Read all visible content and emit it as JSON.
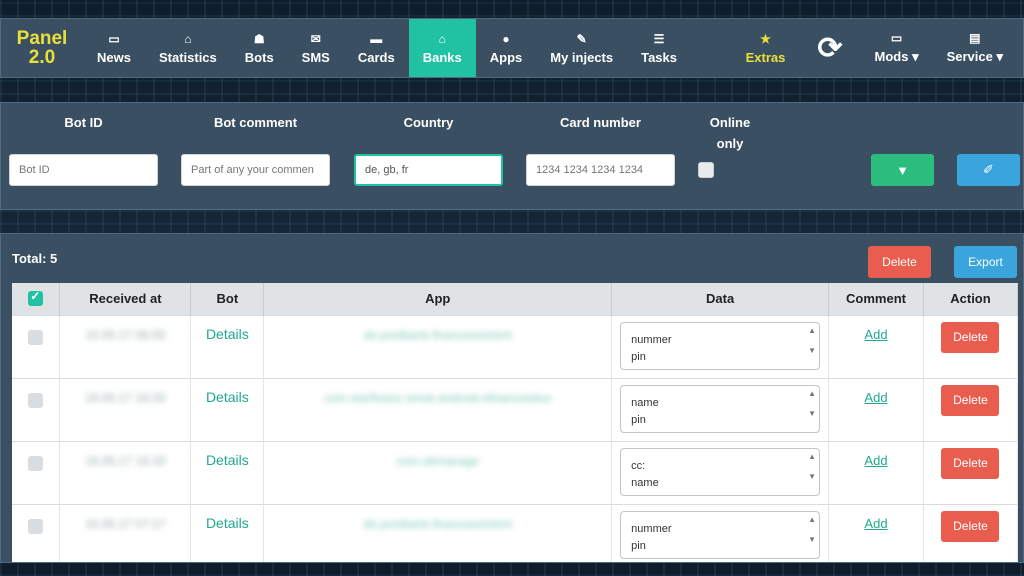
{
  "logo": {
    "line1": "Panel",
    "line2": "2.0"
  },
  "nav": [
    {
      "icon": "news-icon",
      "glyph": "▭",
      "label": "News",
      "active": false
    },
    {
      "icon": "chart-icon",
      "glyph": "⌂",
      "label": "Statistics",
      "active": false
    },
    {
      "icon": "bots-icon",
      "glyph": "☗",
      "label": "Bots",
      "active": false
    },
    {
      "icon": "envelope-icon",
      "glyph": "✉",
      "label": "SMS",
      "active": false
    },
    {
      "icon": "card-icon",
      "glyph": "▬",
      "label": "Cards",
      "active": false
    },
    {
      "icon": "bank-icon",
      "glyph": "⌂",
      "label": "Banks",
      "active": true
    },
    {
      "icon": "android-icon",
      "glyph": "●",
      "label": "Apps",
      "active": false
    },
    {
      "icon": "syringe-icon",
      "glyph": "✎",
      "label": "My injects",
      "active": false
    },
    {
      "icon": "tasks-icon",
      "glyph": "☰",
      "label": "Tasks",
      "active": false
    }
  ],
  "extras": {
    "glyph": "★",
    "label": "Extras"
  },
  "refresh_glyph": "⟳",
  "mods": {
    "glyph": "▭",
    "label": "Mods ▾"
  },
  "service": {
    "glyph": "▤",
    "label": "Service ▾"
  },
  "filters": {
    "bot_id_label": "Bot ID",
    "bot_id_placeholder": "Bot ID",
    "bot_comment_label": "Bot comment",
    "bot_comment_placeholder": "Part of any your commen",
    "country_label": "Country",
    "country_value": "de, gb, fr",
    "card_label": "Card number",
    "card_placeholder": "1234 1234 1234 1234",
    "online_label_1": "Online",
    "online_label_2": "only",
    "filter_glyph": "▼",
    "clear_glyph": "✐"
  },
  "table": {
    "total": "Total: 5",
    "delete_label": "Delete",
    "export_label": "Export",
    "headers": [
      "",
      "Received at",
      "Bot",
      "App",
      "Data",
      "Comment",
      "Action"
    ],
    "rows": [
      {
        "received": "15.05.17 06:55",
        "bot": "Details",
        "app": "de.postbank.finanzassistent",
        "data1": "nummer",
        "data2": "pin",
        "comment": "Add",
        "action": "Delete"
      },
      {
        "received": "16.05.17 16:33",
        "bot": "Details",
        "app": "com.starfinanz.smob.android.sfinanzstatus",
        "data1": "name",
        "data2": "pin",
        "comment": "Add",
        "action": "Delete"
      },
      {
        "received": "16.05.17 16:33",
        "bot": "Details",
        "app": "com.ubmanage",
        "data1": "cc:",
        "data2": "name",
        "comment": "Add",
        "action": "Delete"
      },
      {
        "received": "15.05.17 07:17",
        "bot": "Details",
        "app": "de.postbank.finanzassistent",
        "data1": "nummer",
        "data2": "pin",
        "comment": "Add",
        "action": "Delete"
      }
    ]
  }
}
